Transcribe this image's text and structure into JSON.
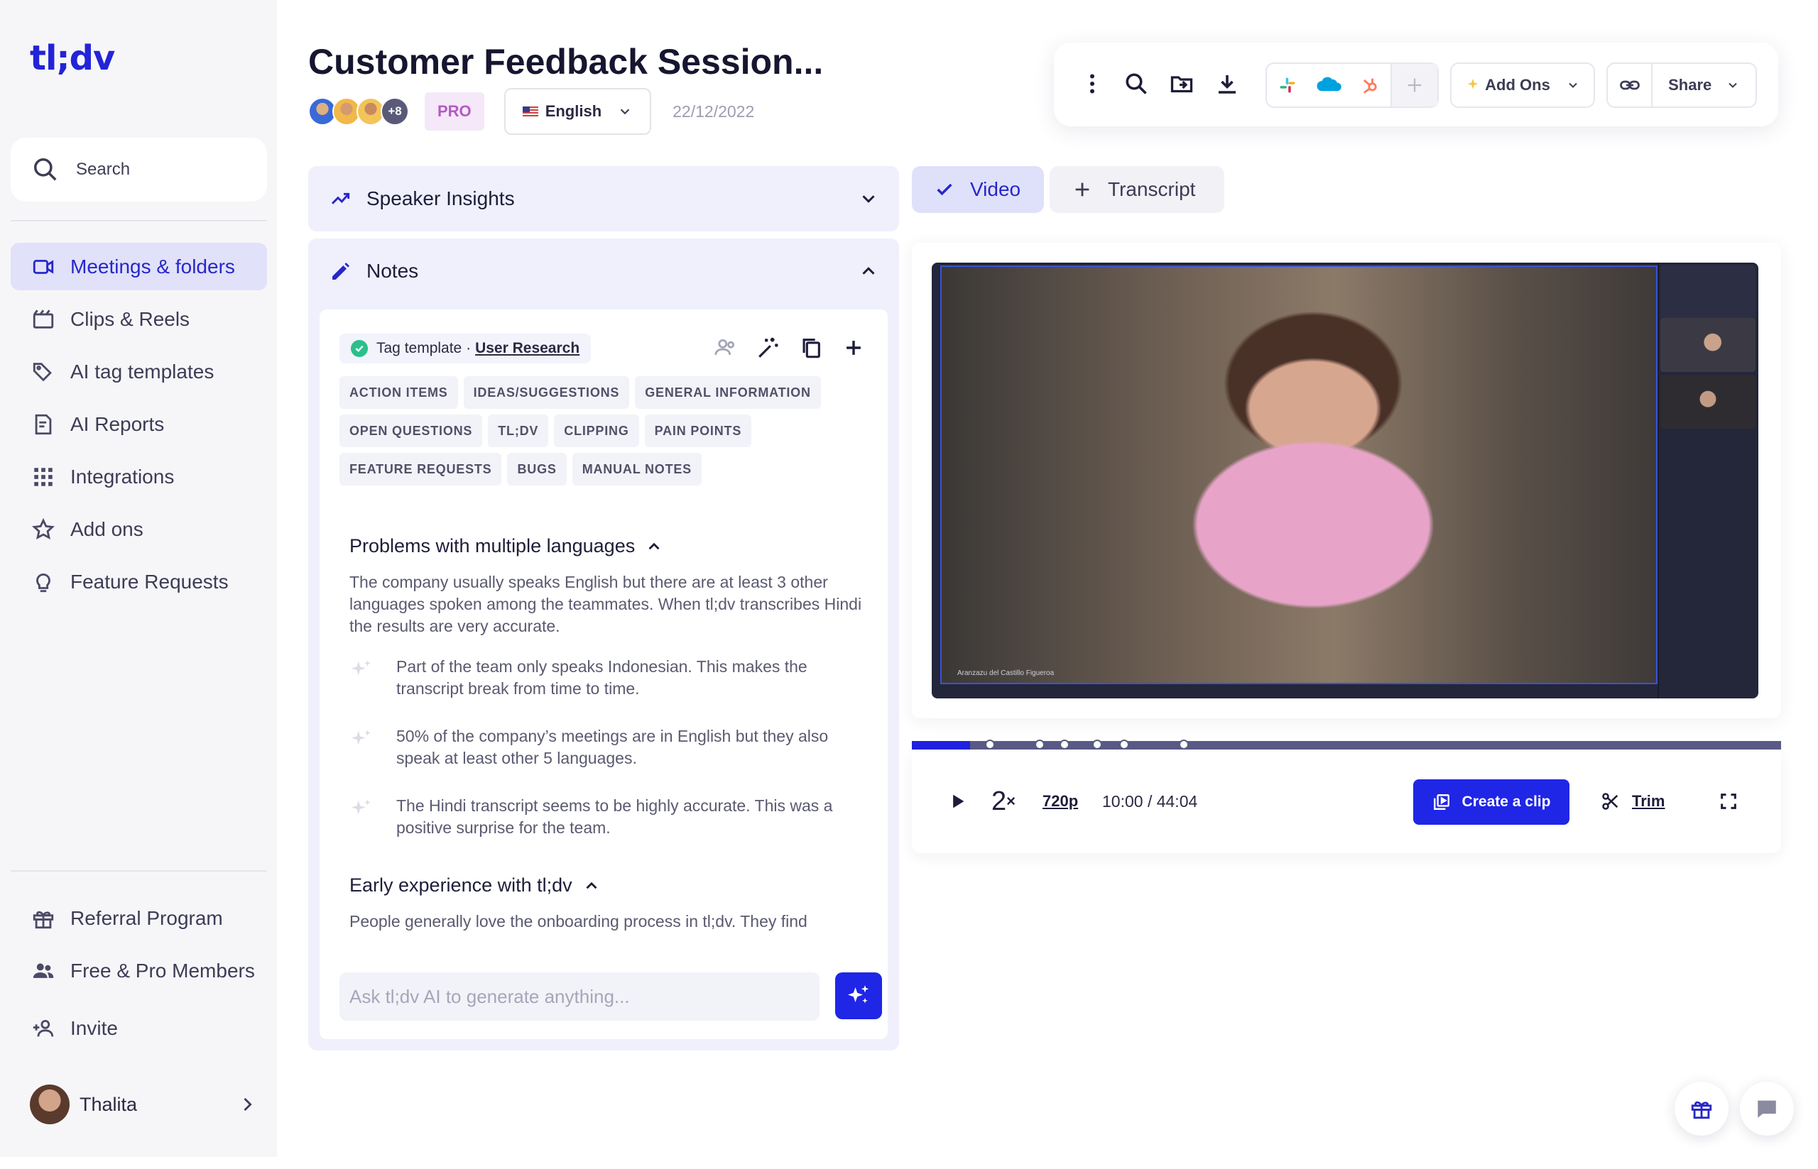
{
  "app": {
    "logo": "tl;dv"
  },
  "sidebar": {
    "search_label": "Search",
    "nav": [
      {
        "label": "Meetings & folders",
        "icon": "video-camera-icon",
        "active": true
      },
      {
        "label": "Clips & Reels",
        "icon": "clapperboard-icon"
      },
      {
        "label": "AI tag templates",
        "icon": "tag-sparkle-icon"
      },
      {
        "label": "AI Reports",
        "icon": "report-icon"
      },
      {
        "label": "Integrations",
        "icon": "grid-icon"
      },
      {
        "label": "Add ons",
        "icon": "star-icon"
      },
      {
        "label": "Feature Requests",
        "icon": "lightbulb-icon"
      }
    ],
    "bottom_nav": [
      {
        "label": "Referral Program",
        "icon": "gift-icon"
      },
      {
        "label": "Free & Pro Members",
        "icon": "members-icon"
      },
      {
        "label": "Invite",
        "icon": "add-person-icon"
      }
    ],
    "user": {
      "name": "Thalita"
    }
  },
  "header": {
    "title": "Customer Feedback Session...",
    "participants_more": "+8",
    "plan_badge": "PRO",
    "language": "English",
    "date": "22/12/2022"
  },
  "toolbar": {
    "addons_label": "Add Ons",
    "share_label": "Share"
  },
  "left_panel": {
    "speaker_insights_label": "Speaker Insights",
    "notes_label": "Notes",
    "tag_template_prefix": "Tag template ·",
    "tag_template_name": "User Research",
    "tags": [
      "ACTION ITEMS",
      "IDEAS/SUGGESTIONS",
      "GENERAL INFORMATION",
      "OPEN QUESTIONS",
      "TL;DV",
      "CLIPPING",
      "PAIN POINTS",
      "FEATURE REQUESTS",
      "BUGS",
      "MANUAL NOTES"
    ],
    "section1": {
      "title": "Problems with multiple languages",
      "body": "The company usually speaks English but there are at least 3 other languages spoken among the teammates. When tl;dv transcribes Hindi the results are very accurate.",
      "bullets": [
        "Part of the team only speaks Indonesian. This makes the transcript break from time to time.",
        "50% of the company’s meetings are in English but they also speak at least other 5 languages.",
        "The Hindi transcript seems to be highly accurate. This was a positive surprise for the team."
      ]
    },
    "section2": {
      "title": "Early experience with tl;dv",
      "body": "People generally love the onboarding process in tl;dv. They find"
    },
    "ai_input_placeholder": "Ask tl;dv AI to generate anything..."
  },
  "right_panel": {
    "tab_video": "Video",
    "tab_transcript": "Transcript",
    "video_caption": "Aranzazu del Castillo Figueroa",
    "player": {
      "speed": "2",
      "speed_suffix": "×",
      "resolution": "720p",
      "time": "10:00 / 44:04",
      "progress_fraction": 0.067,
      "markers": [
        0.09,
        0.147,
        0.176,
        0.213,
        0.244,
        0.313
      ],
      "create_clip_label": "Create a clip",
      "trim_label": "Trim"
    }
  },
  "colors": {
    "accent": "#1f26e6",
    "active_nav_bg": "#e1e1fa",
    "panel_bg": "#eff0fb"
  }
}
